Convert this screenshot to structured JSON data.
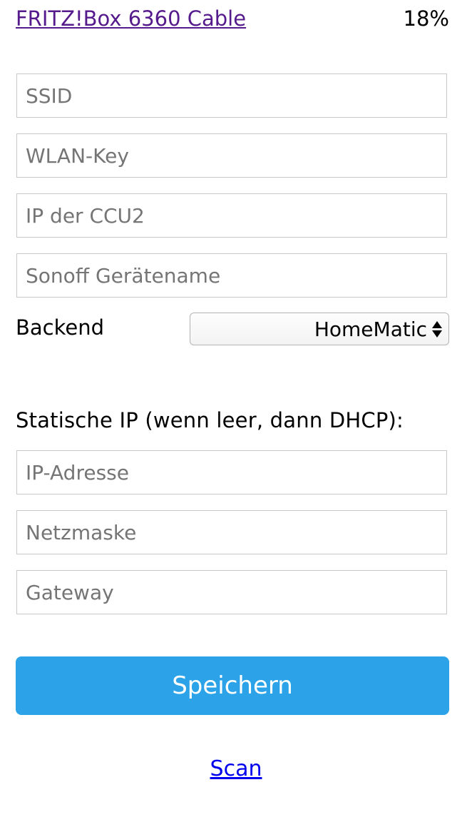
{
  "network": {
    "ssid_link": "FRITZ!Box 6360 Cable",
    "signal": "18%"
  },
  "wifi": {
    "ssid_placeholder": "SSID",
    "key_placeholder": "WLAN-Key",
    "ccu_ip_placeholder": "IP der CCU2",
    "device_name_placeholder": "Sonoff Gerätename"
  },
  "backend": {
    "label": "Backend",
    "selected": "HomeMatic"
  },
  "static_ip": {
    "heading": "Statische IP (wenn leer, dann DHCP):",
    "ip_placeholder": "IP-Adresse",
    "netmask_placeholder": "Netzmaske",
    "gateway_placeholder": "Gateway"
  },
  "actions": {
    "save_label": "Speichern",
    "scan_label": "Scan"
  },
  "colors": {
    "save_button": "#2ca3e8",
    "visited_link": "#551a8b",
    "link": "#0000ee"
  }
}
